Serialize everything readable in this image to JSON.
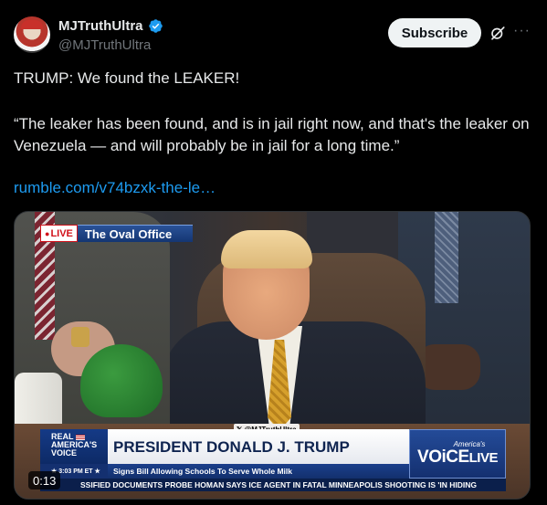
{
  "author": {
    "display_name": "MJTruthUltra",
    "handle": "@MJTruthUltra",
    "avatar_icon": "profile-photo"
  },
  "actions": {
    "subscribe_label": "Subscribe",
    "grok_icon": "grok-icon",
    "more_icon": "more-icon"
  },
  "post": {
    "headline": "TRUMP: We found the LEAKER!",
    "quote": "“The leaker has been found, and is in jail right now, and that's the leaker on Venezuela — and will probably be in jail for a long time.”",
    "link": "rumble.com/v74bzxk-the-le…"
  },
  "video": {
    "live_label": "LIVE",
    "location_title": "The Oval Office",
    "watermark": "@MJTruthUltra",
    "network_logo_line1": "REAL",
    "network_logo_line2": "AMERICA'S",
    "network_logo_line3": "VOICE",
    "headline": "PRESIDENT DONALD J. TRUMP",
    "subheadline": "Signs Bill Allowing Schools To Serve Whole Milk",
    "time_on_screen": "3:03 PM ET",
    "ticker": "SSIFIED DOCUMENTS PROBE      HOMAN SAYS ICE AGENT IN FATAL MINNEAPOLIS SHOOTING IS 'IN HIDING",
    "brand_small": "America's",
    "brand_big": "VOiCE",
    "brand_live": "LIVE",
    "timecode": "0:13"
  },
  "colors": {
    "background": "#000000",
    "text": "#e7e9ea",
    "secondary": "#71767b",
    "link": "#1d9bf0",
    "verified": "#1d9bf0"
  }
}
